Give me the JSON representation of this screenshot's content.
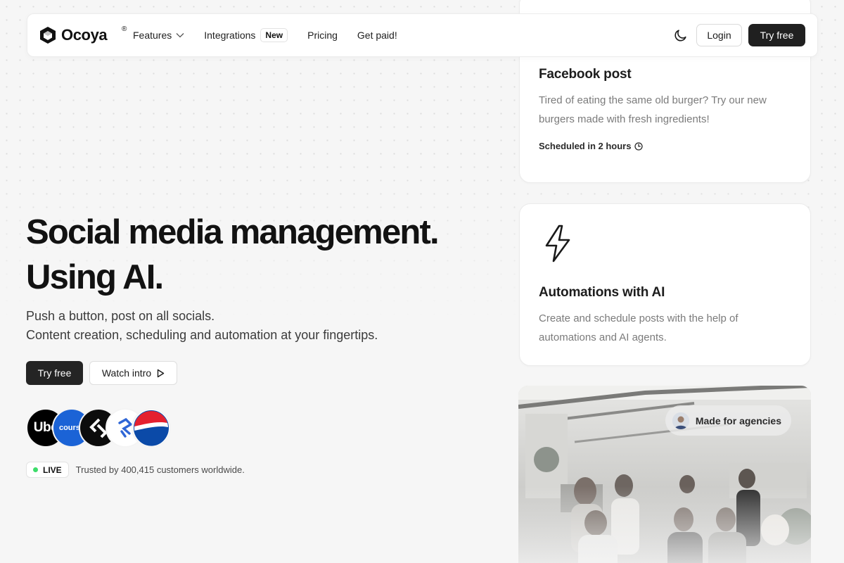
{
  "nav": {
    "brand": "Ocoya",
    "registered": "®",
    "links": [
      {
        "label": "Features"
      },
      {
        "label": "Integrations",
        "badge": "New"
      },
      {
        "label": "Pricing"
      },
      {
        "label": "Get paid!"
      }
    ],
    "login_label": "Login",
    "try_label": "Try free"
  },
  "hero": {
    "title_line1": "Social media management.",
    "title_line2": "Using AI.",
    "sub_line1": "Push a button, post on all socials.",
    "sub_line2": "Content creation, scheduling and automation at your fingertips.",
    "try_label": "Try free",
    "watch_label": "Watch intro",
    "customer_logos": [
      {
        "name": "uber",
        "text": "Ube",
        "bg": "#000000",
        "fg": "#ffffff"
      },
      {
        "name": "coursera",
        "text": "course",
        "bg": "#1b63d6",
        "fg": "#ffffff"
      },
      {
        "name": "toptal",
        "text": "",
        "bg": "#0c0c0c",
        "fg": "#ffffff"
      },
      {
        "name": "toptal-blue",
        "text": "",
        "bg": "#ffffff",
        "fg": "#2f66d6"
      },
      {
        "name": "pepsi",
        "text": "",
        "bg": "#ffffff",
        "fg": "#0b4aa8"
      }
    ],
    "live_label": "LIVE",
    "trusted_text": "Trusted by 400,415 customers worldwide."
  },
  "cards": {
    "facebook": {
      "title": "Facebook post",
      "body": "Tired of eating the same old burger? Try our new burgers made with fresh ingredients!",
      "scheduled": "Scheduled in 2 hours"
    },
    "automation": {
      "title": "Automations with AI",
      "body": "Create and schedule posts with the help of automations and AI agents."
    },
    "agency_badge": "Made for agencies"
  },
  "colors": {
    "primary_button": "#202020",
    "live_dot": "#3ddc6a",
    "background": "#f6f6f6"
  }
}
